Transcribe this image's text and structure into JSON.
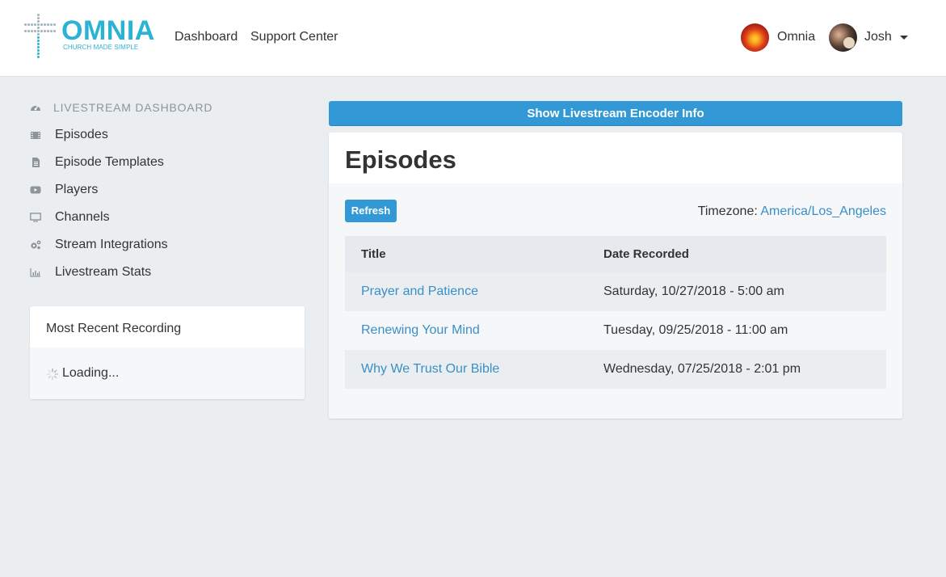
{
  "header": {
    "logo": {
      "word": "OMNIA",
      "tagline": "CHURCH MADE SIMPLE"
    },
    "nav": [
      {
        "label": "Dashboard"
      },
      {
        "label": "Support Center"
      }
    ],
    "org": {
      "name": "Omnia"
    },
    "user": {
      "name": "Josh"
    }
  },
  "sidebar": {
    "heading": {
      "label": "LIVESTREAM DASHBOARD",
      "icon": "dashboard-gauge-icon"
    },
    "items": [
      {
        "label": "Episodes",
        "icon": "film-icon"
      },
      {
        "label": "Episode Templates",
        "icon": "file-icon"
      },
      {
        "label": "Players",
        "icon": "youtube-play-icon"
      },
      {
        "label": "Channels",
        "icon": "monitor-icon"
      },
      {
        "label": "Stream Integrations",
        "icon": "gears-icon"
      },
      {
        "label": "Livestream Stats",
        "icon": "bar-chart-icon"
      }
    ],
    "recent": {
      "title": "Most Recent Recording",
      "status": "Loading..."
    }
  },
  "main": {
    "encoder_button": "Show Livestream Encoder Info",
    "episodes": {
      "title": "Episodes",
      "refresh_label": "Refresh",
      "timezone_label": "Timezone:",
      "timezone_value": "America/Los_Angeles",
      "columns": [
        "Title",
        "Date Recorded"
      ],
      "rows": [
        {
          "title": "Prayer and Patience",
          "date": "Saturday, 10/27/2018 - 5:00 am"
        },
        {
          "title": "Renewing Your Mind",
          "date": "Tuesday, 09/25/2018 - 11:00 am"
        },
        {
          "title": "Why We Trust Our Bible",
          "date": "Wednesday, 07/25/2018 - 2:01 pm"
        }
      ]
    }
  },
  "colors": {
    "accent": "#3399d6",
    "link": "#3a8fc7",
    "brand": "#2bb3d3",
    "page_bg": "#ebeef1"
  }
}
